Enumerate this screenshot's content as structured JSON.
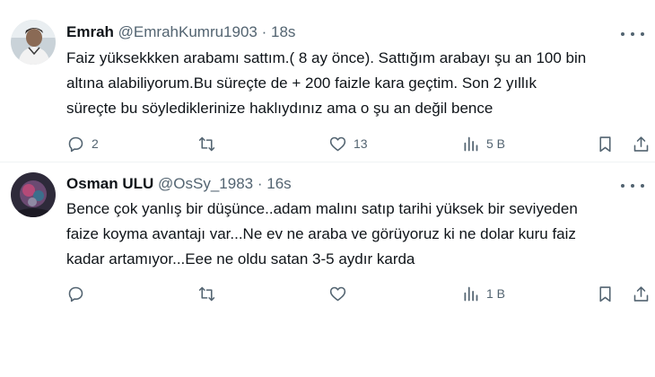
{
  "tweets": [
    {
      "name": "Emrah",
      "handle": "@EmrahKumru1903",
      "separator": "·",
      "time": "18s",
      "lines": [
        "Faiz yüksekkken arabamı sattım.( 8 ay önce). Sattığım arabayı şu an 100 bin",
        "altına alabiliyorum.Bu süreçte de + 200 faizle kara geçtim.   Son 2 yıllık",
        "süreçte bu söylediklerinize haklıydınız ama o şu an değil bence"
      ],
      "replies": "2",
      "retweets": "",
      "likes": "13",
      "views": "5 B"
    },
    {
      "name": "Osman ULU",
      "handle": "@OsSy_1983",
      "separator": "·",
      "time": "16s",
      "lines": [
        "Bence çok yanlış bir düşünce..adam malını satıp tarihi yüksek bir seviyeden",
        "faize koyma avantajı var...Ne ev ne araba ve görüyoruz ki ne dolar kuru faiz",
        "kadar artamıyor...Eee ne oldu satan 3-5 aydır karda"
      ],
      "replies": "",
      "retweets": "",
      "likes": "",
      "views": "1 B"
    }
  ],
  "icons": {
    "reply": "reply-icon",
    "retweet": "retweet-icon",
    "like": "heart-icon",
    "views": "views-icon",
    "bookmark": "bookmark-icon",
    "share": "share-icon",
    "more": "more-icon"
  },
  "colors": {
    "text": "#0f1419",
    "secondary": "#536471",
    "divider": "#eff3f4"
  }
}
